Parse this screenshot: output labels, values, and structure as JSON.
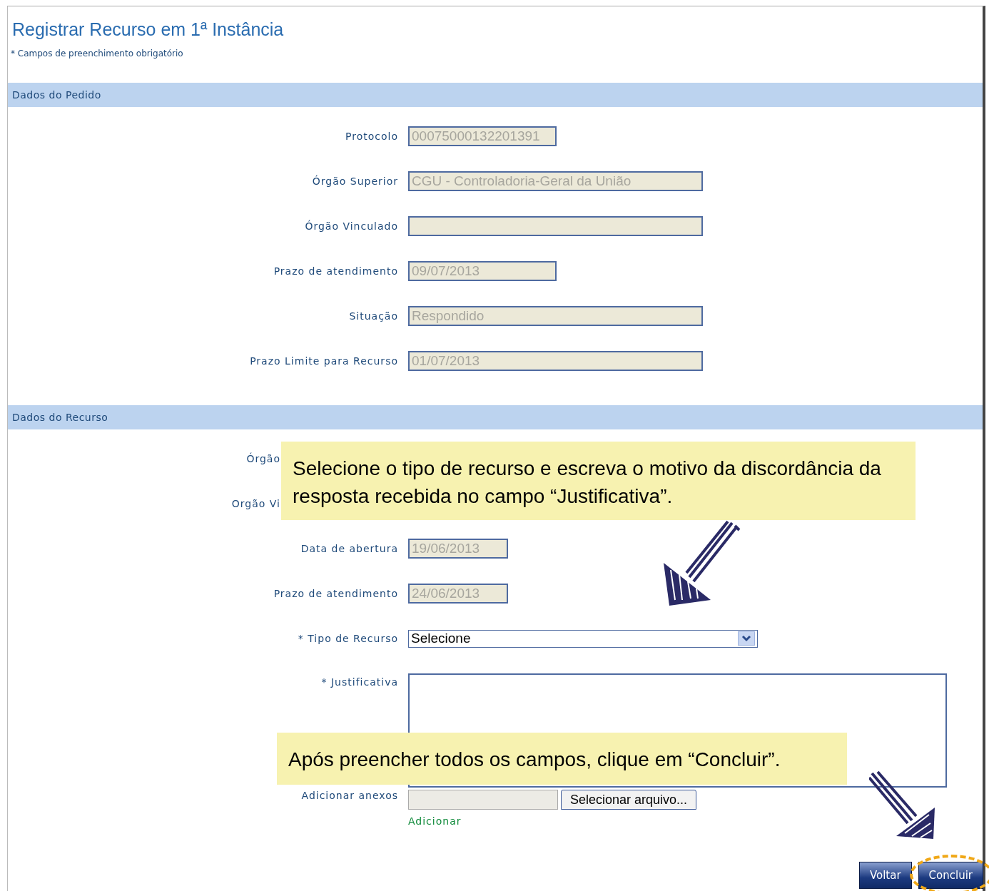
{
  "title": "Registrar Recurso em 1ª Instância",
  "required_note": "* Campos de preenchimento obrigatório",
  "sections": [
    {
      "title": "Dados do Pedido",
      "fields": [
        {
          "label": "Protocolo",
          "kind": "short",
          "value": "00075000132201391",
          "disabled": true
        },
        {
          "label": "Órgão Superior",
          "kind": "long",
          "value": "CGU - Controladoria-Geral da União",
          "disabled": true
        },
        {
          "label": "Órgão Vinculado",
          "kind": "long",
          "disabled": true
        },
        {
          "label": "Prazo de atendimento",
          "kind": "short",
          "value": "09/07/2013",
          "disabled": true
        },
        {
          "label": "Situação",
          "kind": "long",
          "value": "Respondido",
          "disabled": true
        },
        {
          "label": "Prazo Limite para Recurso",
          "kind": "long",
          "value": "01/07/2013",
          "disabled": true
        }
      ]
    },
    {
      "title": "Dados do Recurso",
      "fields": [
        {
          "label": "Órgão",
          "kind": "covered"
        },
        {
          "label": "Orgão Vi",
          "kind": "covered"
        },
        {
          "label": "Data de abertura",
          "kind": "date",
          "value": "19/06/2013",
          "disabled": true
        },
        {
          "label": "Prazo de atendimento",
          "kind": "date",
          "value": "24/06/2013",
          "disabled": true
        },
        {
          "label": "* Tipo de Recurso",
          "kind": "select",
          "value": "Selecione",
          "disabled": false
        },
        {
          "label": "* Justificativa",
          "kind": "textarea",
          "disabled": false
        },
        {
          "label": "Adicionar anexos",
          "kind": "file",
          "button": "Selecionar arquivo...",
          "link": "Adicionar"
        }
      ]
    }
  ],
  "buttons": [
    {
      "label": "Voltar",
      "highlighted": false
    },
    {
      "label": "Concluir",
      "highlighted": true
    }
  ],
  "callouts": [
    {
      "text": "Selecione o tipo de recurso e escreva o motivo da discordância da resposta recebida no campo “Justificativa”."
    },
    {
      "text": "Após preencher todos os campos, clique em “Concluir”."
    }
  ]
}
